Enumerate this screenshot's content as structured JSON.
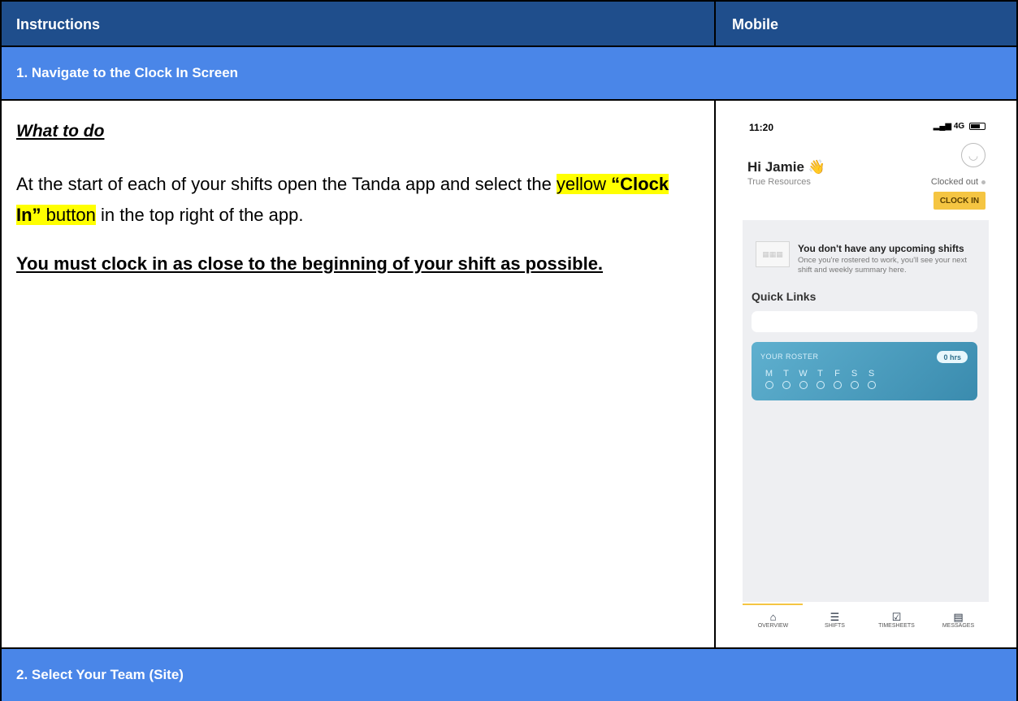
{
  "header": {
    "instructions": "Instructions",
    "mobile": "Mobile"
  },
  "section1": {
    "title": "1. Navigate to the Clock In Screen"
  },
  "body": {
    "what_to_do": "What to do",
    "para_part1": "At the start of each of your shifts open the Tanda app and select the ",
    "para_hl1": "yellow ",
    "para_hl_bold": "“Clock In”",
    "para_hl2": " button",
    "para_part2": " in the top right of the app.",
    "must": "You must clock in as close to the beginning of your shift as possible."
  },
  "phone": {
    "time": "11:20",
    "signal": "4G",
    "greeting": "Hi Jamie 👋",
    "company": "True Resources",
    "status": "Clocked out",
    "clock_in": "CLOCK IN",
    "no_shifts_title": "You don't have any upcoming shifts",
    "no_shifts_sub": "Once you're rostered to work, you'll see your next shift and weekly summary here.",
    "quick_links": "Quick Links",
    "roster_label": "YOUR ROSTER",
    "roster_hours": "0 hrs",
    "days": [
      "M",
      "T",
      "W",
      "T",
      "F",
      "S",
      "S"
    ],
    "tabs": [
      {
        "label": "OVERVIEW",
        "icon": "home-icon"
      },
      {
        "label": "SHIFTS",
        "icon": "shifts-icon"
      },
      {
        "label": "TIMESHEETS",
        "icon": "timesheets-icon"
      },
      {
        "label": "MESSAGES",
        "icon": "messages-icon"
      }
    ],
    "accent": "#f5c542"
  },
  "section2": {
    "title": "2. Select Your Team (Site)"
  }
}
